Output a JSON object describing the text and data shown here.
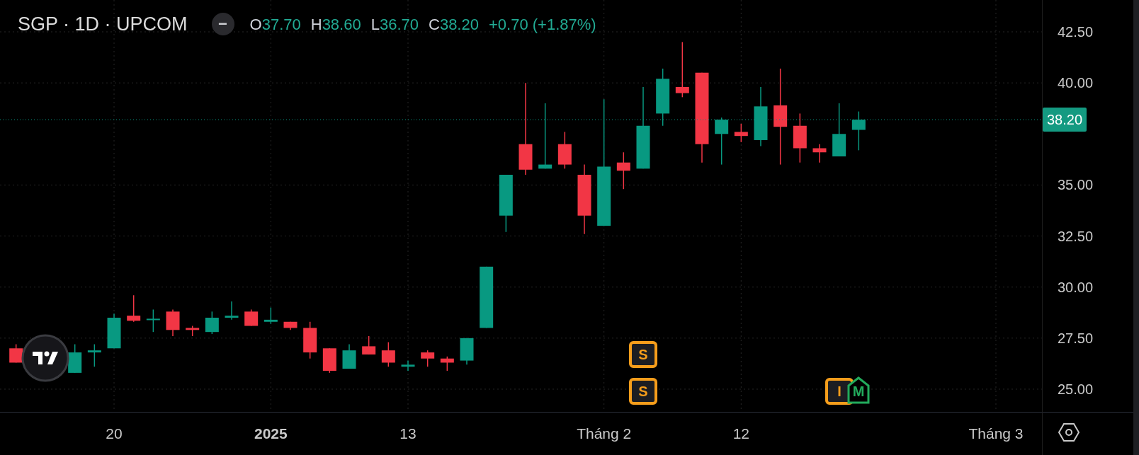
{
  "legend": {
    "title": "SGP · 1D · UPCOM",
    "collapse_button": {
      "label": "−"
    },
    "ohlc": [
      {
        "label": "O",
        "value": "37.70"
      },
      {
        "label": "H",
        "value": "38.60"
      },
      {
        "label": "L",
        "value": "36.70"
      },
      {
        "label": "C",
        "value": "38.20"
      }
    ],
    "change": "+0.70 (+1.87%)"
  },
  "event_markers": [
    {
      "label": "S",
      "kind": "box",
      "color": "#f59d1b"
    },
    {
      "label": "S",
      "kind": "box",
      "color": "#f59d1b"
    },
    {
      "label": "I",
      "kind": "box",
      "color": "#f59d1b"
    },
    {
      "label": "M",
      "kind": "flag",
      "color": "#22ab5c"
    }
  ],
  "price_axis": [
    "42.50",
    "40.00",
    "35.00",
    "32.50",
    "30.00",
    "27.50",
    "25.00"
  ],
  "last_price": {
    "label": "38.20"
  },
  "time_axis": [
    {
      "label": "20",
      "kind": "day"
    },
    {
      "label": "2025",
      "kind": "year"
    },
    {
      "label": "13",
      "kind": "day"
    },
    {
      "label": "Tháng 2",
      "kind": "month"
    },
    {
      "label": "12",
      "kind": "day"
    },
    {
      "label": "Tháng 3",
      "kind": "month"
    }
  ]
}
